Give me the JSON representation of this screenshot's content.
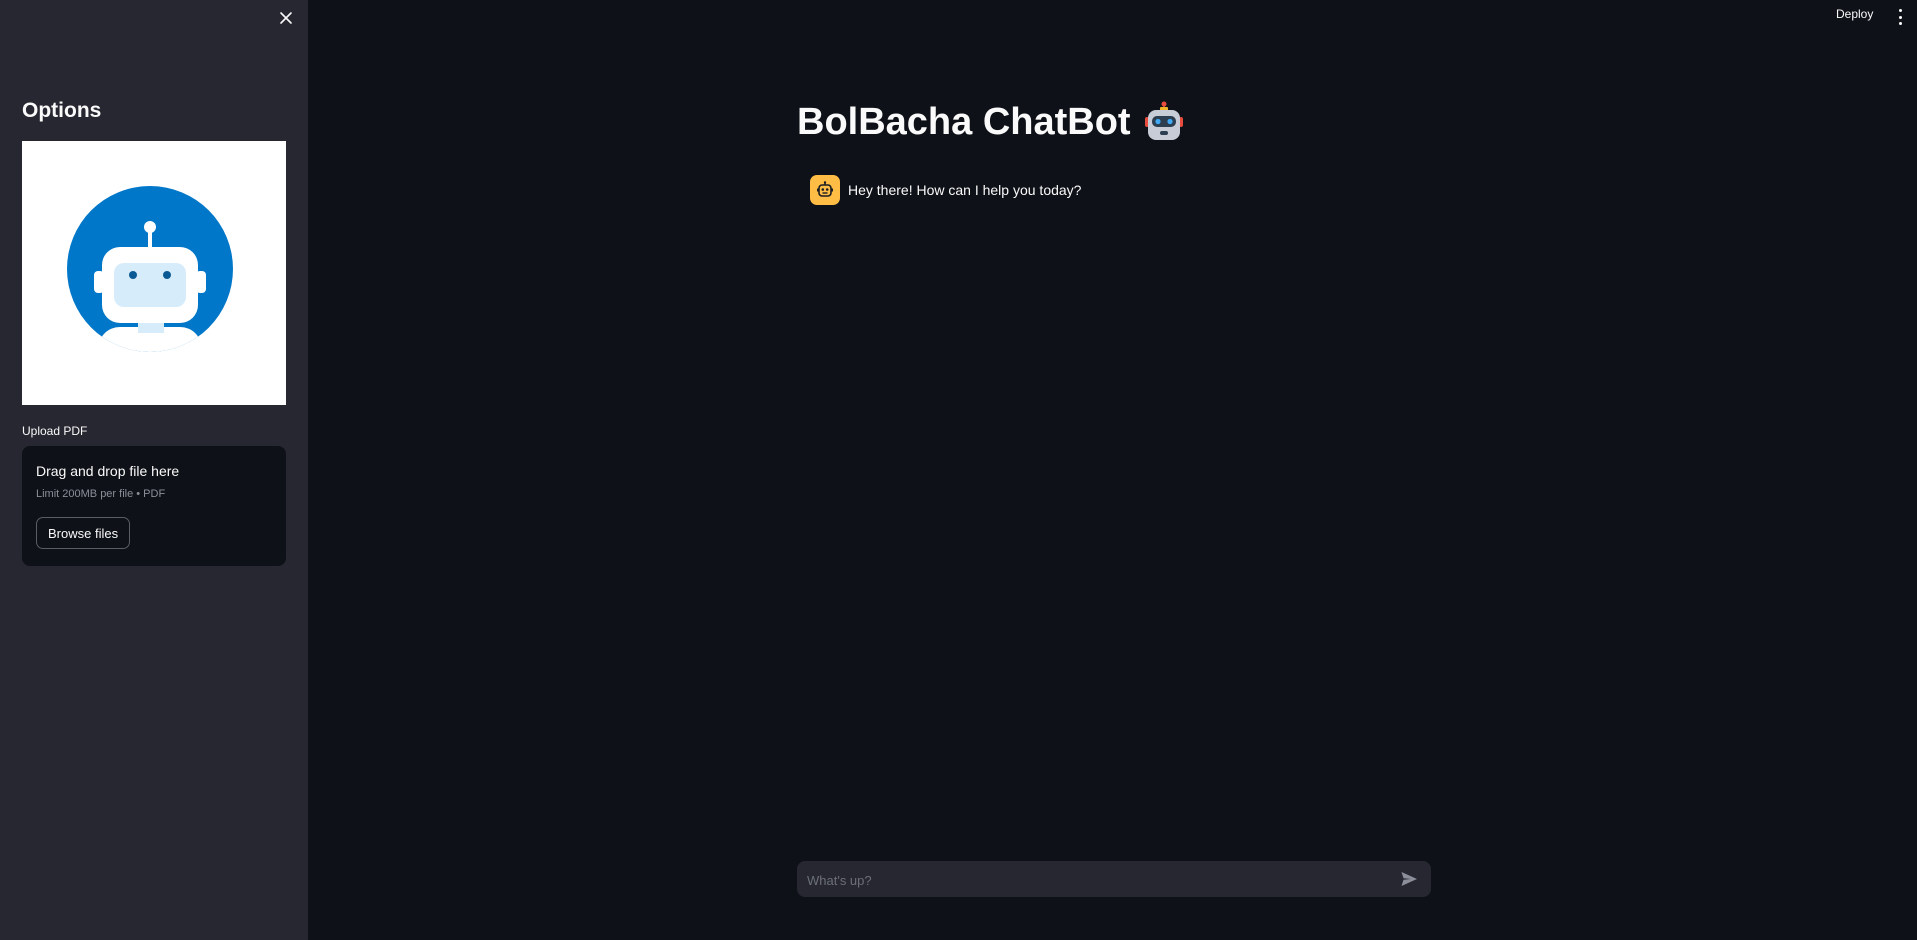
{
  "sidebar": {
    "title": "Options",
    "close_icon": "close-icon",
    "image_icon": "robot-avatar-icon",
    "upload": {
      "label": "Upload PDF",
      "dropzone_title": "Drag and drop file here",
      "limit_text": "Limit 200MB per file • PDF",
      "browse_label": "Browse files"
    }
  },
  "header": {
    "deploy_label": "Deploy",
    "menu_icon": "kebab-menu-icon"
  },
  "main": {
    "title": "BolBacha ChatBot",
    "title_icon": "robot-emoji-icon",
    "messages": [
      {
        "role": "assistant",
        "avatar_icon": "robot-icon",
        "text": "Hey there! How can I help you today?"
      }
    ],
    "chat_input": {
      "placeholder": "What's up?",
      "value": "",
      "send_icon": "send-icon"
    }
  },
  "colors": {
    "background": "#0e1117",
    "sidebar": "#262730",
    "avatar_bg": "#ffbd45",
    "image_blue": "#0077c8"
  }
}
